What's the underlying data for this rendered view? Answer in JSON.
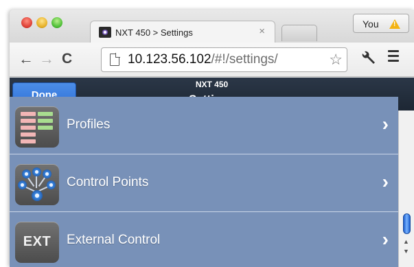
{
  "browser": {
    "tab_title": "NXT 450 > Settings",
    "tab_close": "×",
    "profile_label": "You",
    "url_host": "10.123.56.102",
    "url_path": "/#!/settings/",
    "back_glyph": "←",
    "forward_glyph": "→",
    "reload_glyph": "C",
    "star_glyph": "☆",
    "wrench_glyph": "🔧"
  },
  "app": {
    "done_label": "Done",
    "device_name": "NXT 450",
    "page_title": "Settings",
    "items": [
      {
        "label": "Profiles",
        "icon": "profiles-icon",
        "chevron": "›"
      },
      {
        "label": "Control Points",
        "icon": "control-points-icon",
        "chevron": "›"
      },
      {
        "label": "External Control",
        "icon": "ext-icon",
        "icon_text": "EXT",
        "chevron": "›"
      }
    ]
  },
  "colors": {
    "header_bg": "#232e3c",
    "list_bg": "#7891b8",
    "done_button": "#3a7de0"
  }
}
